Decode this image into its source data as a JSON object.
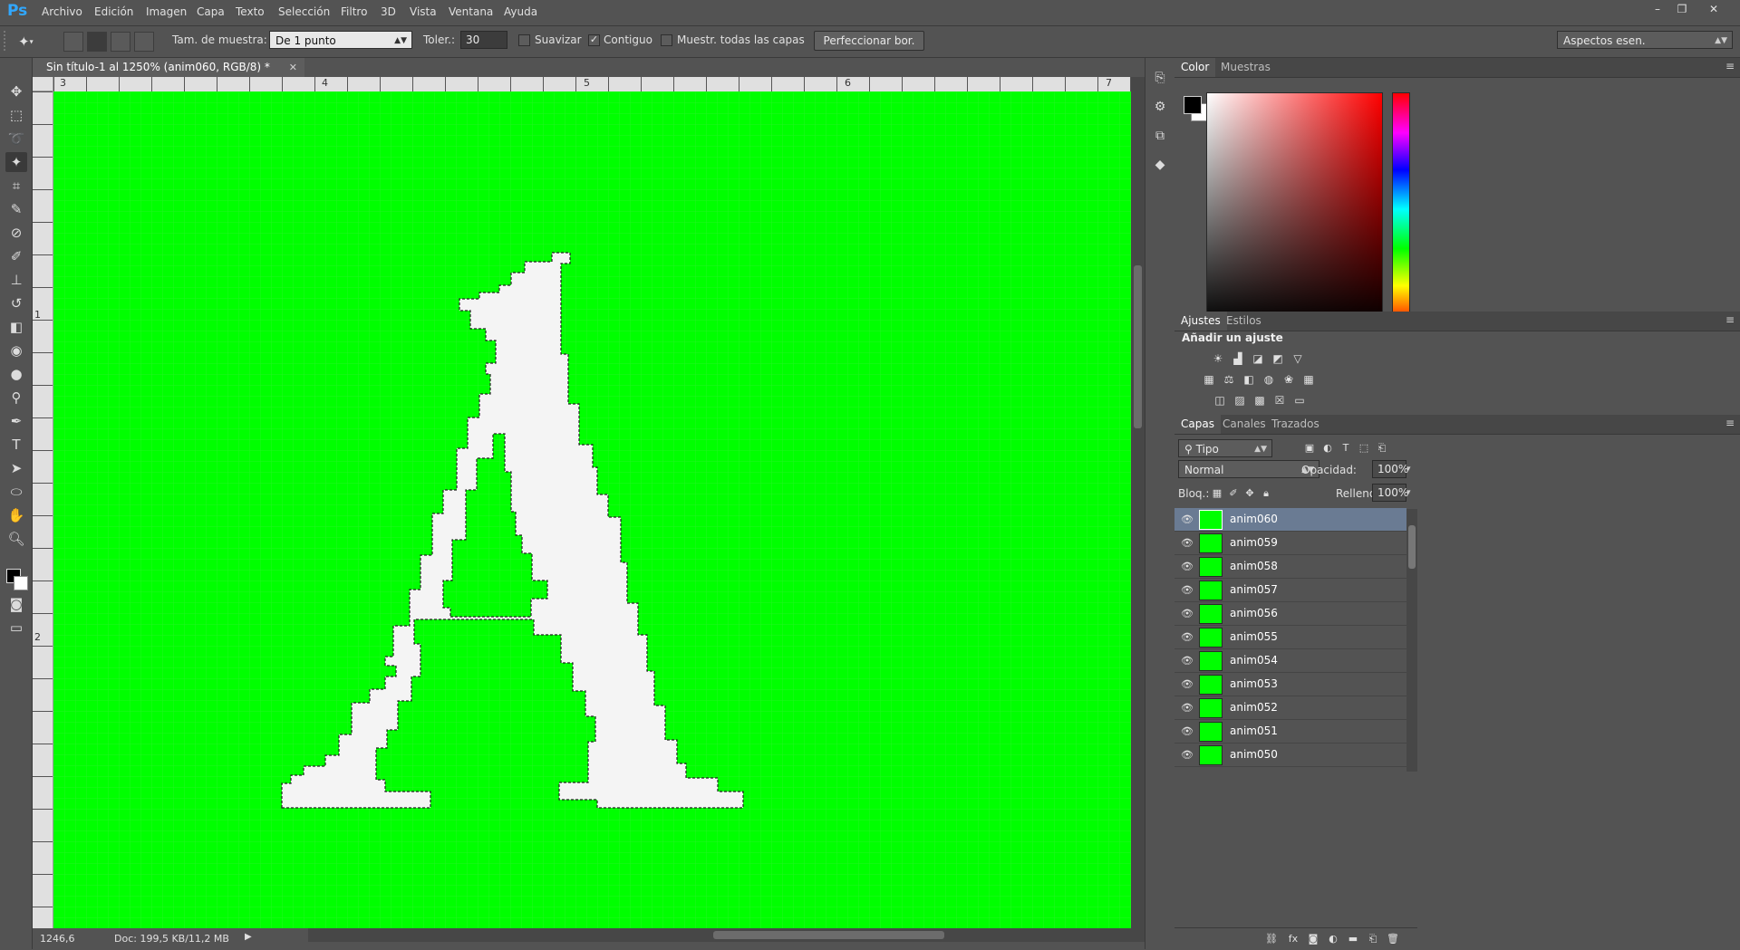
{
  "app": {
    "logo": "Ps"
  },
  "menu": [
    "Archivo",
    "Edición",
    "Imagen",
    "Capa",
    "Texto",
    "Selección",
    "Filtro",
    "3D",
    "Vista",
    "Ventana",
    "Ayuda"
  ],
  "window_controls": {
    "minimize": "–",
    "restore": "❐",
    "close": "✕"
  },
  "options": {
    "sample_size_label": "Tam. de muestra:",
    "sample_size_value": "De 1 punto",
    "tolerance_label": "Toler.:",
    "tolerance_value": "30",
    "antialias_label": "Suavizar",
    "antialias_checked": false,
    "contiguous_label": "Contiguo",
    "contiguous_checked": true,
    "sample_all_label": "Muestr. todas las capas",
    "sample_all_checked": false,
    "refine_edge_label": "Perfeccionar bor.",
    "workspace_value": "Aspectos esen."
  },
  "document": {
    "tab_title": "Sin título-1 al 1250% (anim060, RGB/8) *",
    "ruler_top": [
      "3",
      "4",
      "5",
      "6",
      "7"
    ],
    "ruler_left": [
      "1",
      "2"
    ],
    "zoom": "1246,6",
    "doc_info": "Doc: 199,5 KB/11,2 MB"
  },
  "color_panel": {
    "tabs": [
      "Color",
      "Muestras"
    ],
    "foreground": "#000000",
    "background": "#ffffff"
  },
  "adjustments_panel": {
    "tabs": [
      "Ajustes",
      "Estilos"
    ],
    "heading": "Añadir un ajuste"
  },
  "layers_panel": {
    "tabs": [
      "Capas",
      "Canales",
      "Trazados"
    ],
    "filter_label": "Tipo",
    "blend_mode": "Normal",
    "opacity_label": "Opacidad:",
    "opacity_value": "100%",
    "lock_label": "Bloq.:",
    "fill_label": "Relleno:",
    "fill_value": "100%",
    "layers": [
      {
        "name": "anim060",
        "selected": true
      },
      {
        "name": "anim059",
        "selected": false
      },
      {
        "name": "anim058",
        "selected": false
      },
      {
        "name": "anim057",
        "selected": false
      },
      {
        "name": "anim056",
        "selected": false
      },
      {
        "name": "anim055",
        "selected": false
      },
      {
        "name": "anim054",
        "selected": false
      },
      {
        "name": "anim053",
        "selected": false
      },
      {
        "name": "anim052",
        "selected": false
      },
      {
        "name": "anim051",
        "selected": false
      },
      {
        "name": "anim050",
        "selected": false
      }
    ]
  },
  "colors": {
    "canvas": "#00ff00",
    "selection_fill": "#f4f4f4",
    "ui_bg": "#535353",
    "selected_layer": "#6a7b93"
  }
}
